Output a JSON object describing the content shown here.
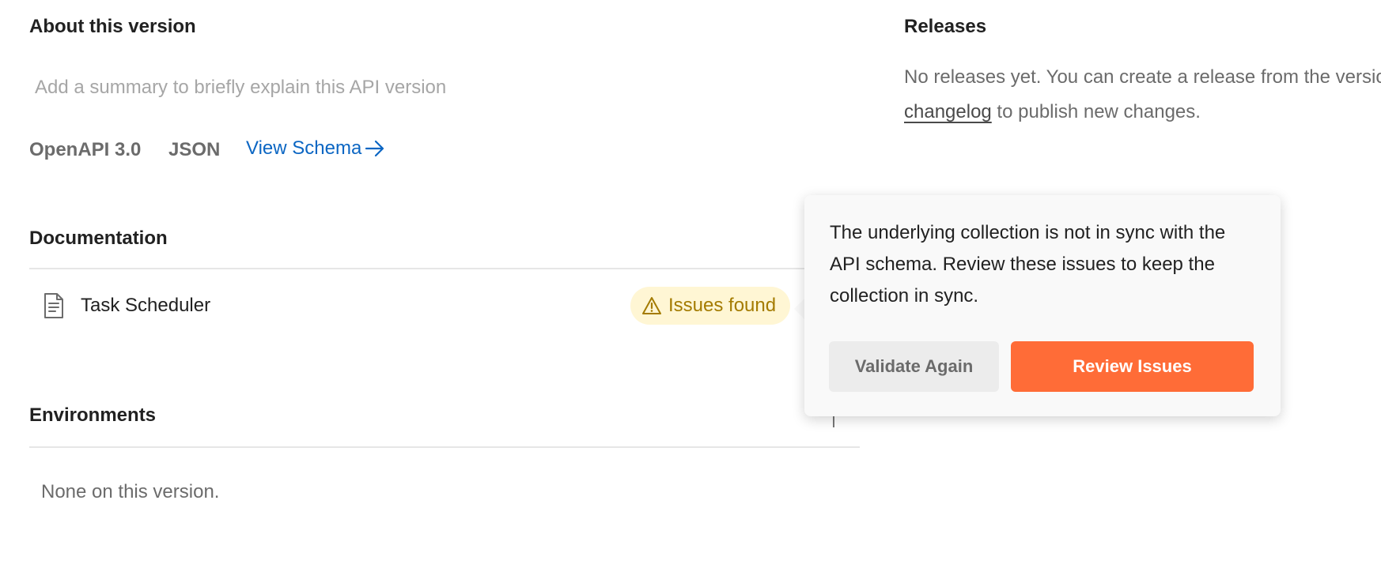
{
  "about": {
    "heading": "About this version",
    "summary_placeholder": "Add a summary to briefly explain this API version",
    "format": "OpenAPI 3.0",
    "language": "JSON",
    "view_schema_label": "View Schema"
  },
  "releases": {
    "heading": "Releases",
    "text_before": "No releases yet. You can create a release from the version ",
    "link_label": "changelog",
    "text_after": " to publish new changes."
  },
  "documentation": {
    "heading": "Documentation",
    "items": [
      {
        "name": "Task Scheduler",
        "badge": "Issues found"
      }
    ]
  },
  "environments": {
    "heading": "Environments",
    "empty_text": "None on this version."
  },
  "popover": {
    "message": "The underlying collection is not in sync with the API schema. Review these issues to keep the collection in sync.",
    "validate_label": "Validate Again",
    "review_label": "Review Issues"
  },
  "colors": {
    "link": "#0b66c3",
    "primary_button": "#ff6c37",
    "warning_badge_bg": "#fff6d4",
    "warning_text": "#a47b00"
  },
  "icons": {
    "document": "document-icon",
    "warning": "warning-triangle-icon",
    "arrow": "arrow-right-icon",
    "add": "plus-icon"
  }
}
